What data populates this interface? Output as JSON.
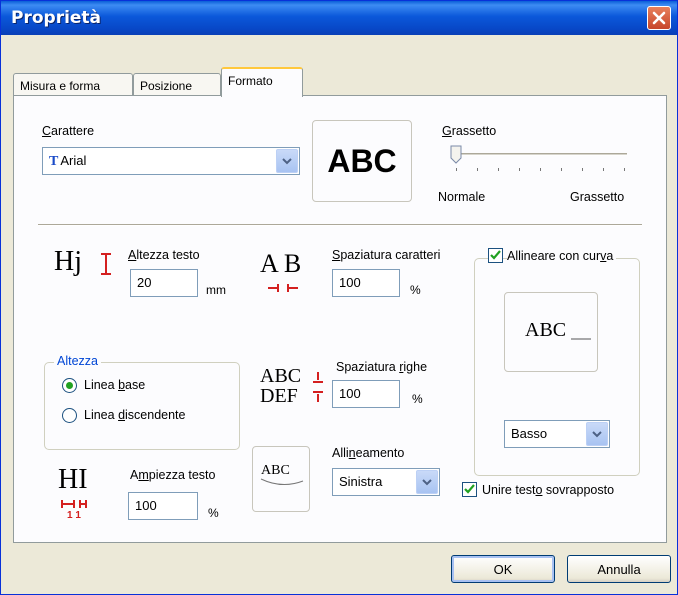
{
  "window": {
    "title": "Proprietà"
  },
  "tabs": [
    {
      "label": "Misura e forma"
    },
    {
      "label": "Posizione"
    },
    {
      "label": "Formato"
    }
  ],
  "font": {
    "label_prefix": "C",
    "label_rest": "arattere",
    "value": "Arial",
    "preview_text": "ABC"
  },
  "bold": {
    "label_prefix": "G",
    "label_rest": "rassetto",
    "min_label": "Normale",
    "max_label": "Grassetto",
    "level": 0
  },
  "text_height": {
    "icon_text": "Hj",
    "label_prefix": "A",
    "label_rest": "ltezza testo",
    "value": "20",
    "unit": "mm"
  },
  "char_spacing": {
    "icon_text": "A B",
    "label_prefix": "S",
    "label_rest": "paziatura caratteri",
    "value": "100",
    "unit": "%"
  },
  "curve": {
    "label_pre": "Allineare con cur",
    "label_u": "v",
    "label_post": "a",
    "checked": true,
    "preview_text": "ABC",
    "position": "Basso"
  },
  "height_group": {
    "title": "Altezza",
    "baseline_pre": "Linea ",
    "baseline_u": "b",
    "baseline_post": "ase",
    "descender_pre": "Linea ",
    "descender_u": "d",
    "descender_post": "iscendente",
    "selected": "baseline"
  },
  "line_spacing": {
    "icon_line1": "ABC",
    "icon_line2": "DEF",
    "label_pre": "Spaziatura ",
    "label_u": "r",
    "label_post": "ighe",
    "value": "100",
    "unit": "%"
  },
  "text_width": {
    "icon_text": "HI",
    "icon_nums": "1 1",
    "label_pre": "A",
    "label_u": "m",
    "label_post": "piezza testo",
    "value": "100",
    "unit": "%"
  },
  "alignment": {
    "preview_text": "ABC",
    "label_pre": "Alli",
    "label_u": "n",
    "label_post": "eamento",
    "value": "Sinistra"
  },
  "merge_overlap": {
    "label_pre": "Unire test",
    "label_u": "o",
    "label_post": " sovrapposto",
    "checked": true
  },
  "buttons": {
    "ok": "OK",
    "cancel": "Annulla"
  },
  "colors": {
    "title_bar": "#0a58da",
    "accent_tab": "#ffc83c",
    "check_green": "#21a121",
    "icon_red": "#d42020"
  }
}
